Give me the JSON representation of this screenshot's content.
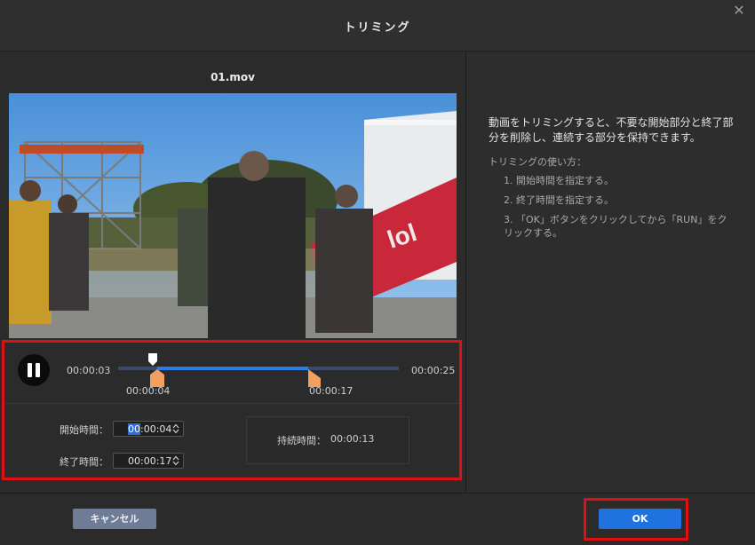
{
  "dialog": {
    "title": "トリミング",
    "close_glyph": "✕",
    "close_icon": "close-icon"
  },
  "video": {
    "filename": "01.mov"
  },
  "player": {
    "current_time": "00:00:03",
    "total_time": "00:00:25",
    "trim_start_label": "00:00:04",
    "trim_end_label": "00:00:17",
    "pause_icon": "pause-icon"
  },
  "fields": {
    "start_label": "開始時間：",
    "start_value_selected": "00",
    "start_value_rest": ":00:04",
    "end_label": "終了時間：",
    "end_value": "00:00:17",
    "duration_label": "持続時間：",
    "duration_value": "00:00:13"
  },
  "help": {
    "description": "動画をトリミングすると、不要な開始部分と終了部分を削除し、連続する部分を保持できます。",
    "howto_title": "トリミングの使い方：",
    "step1": "1. 開始時間を指定する。",
    "step2": "2. 終了時間を指定する。",
    "step3": "3. 「OK」ボタンをクリックしてから「RUN」をクリックする。"
  },
  "footer": {
    "cancel_label": "キャンセル",
    "ok_label": "OK"
  },
  "colors": {
    "accent": "#1f72e0",
    "highlight_frame": "#e01010",
    "handle": "#f0a060"
  }
}
